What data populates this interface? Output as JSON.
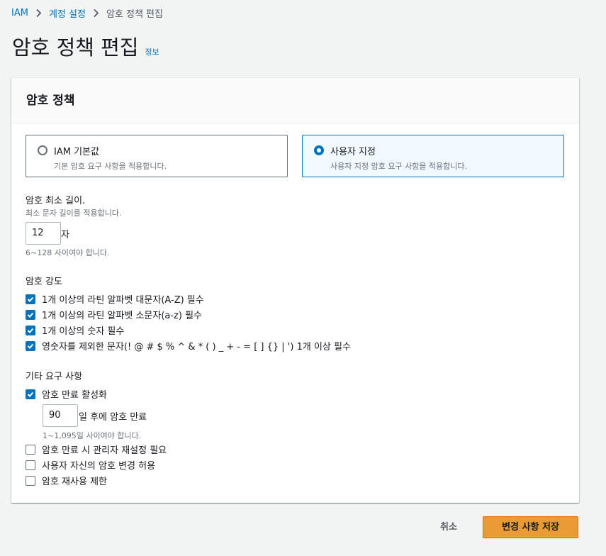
{
  "breadcrumb": {
    "root": "IAM",
    "parent": "계정 설정",
    "current": "암호 정책 편집"
  },
  "page": {
    "title": "암호 정책 편집",
    "info": "정보"
  },
  "card": {
    "title": "암호 정책"
  },
  "policy_options": [
    {
      "label": "IAM 기본값",
      "description": "기본 암호 요구 사항을 적용합니다.",
      "selected": false
    },
    {
      "label": "사용자 지정",
      "description": "사용자 지정 암호 요구 사항을 적용합니다.",
      "selected": true
    }
  ],
  "min_length": {
    "label": "암호 최소 길이.",
    "description": "최소 문자 길이를 적용합니다.",
    "value": "12",
    "unit": "자",
    "hint": "6~128 사이여야 합니다."
  },
  "strength": {
    "label": "암호 강도",
    "items": [
      {
        "label": "1개 이상의 라틴 알파벳 대문자(A-Z) 필수",
        "checked": true
      },
      {
        "label": "1개 이상의 라틴 알파벳 소문자(a-z) 필수",
        "checked": true
      },
      {
        "label": "1개 이상의 숫자 필수",
        "checked": true
      },
      {
        "label": "영숫자를 제외한 문자(! @ # $ % ^ & * ( ) _ + - = [ ] {} | ') 1개 이상 필수",
        "checked": true
      }
    ]
  },
  "other": {
    "label": "기타 요구 사항",
    "expiration": {
      "label": "암호 만료 활성화",
      "checked": true
    },
    "expiration_days": {
      "value": "90",
      "suffix": "일 후에 암호 만료",
      "hint": "1~1,095일 사이여야 합니다."
    },
    "items": [
      {
        "label": "암호 만료 시 관리자 재설정 필요",
        "checked": false
      },
      {
        "label": "사용자 자신의 암호 변경 허용",
        "checked": false
      },
      {
        "label": "암호 재사용 제한",
        "checked": false
      }
    ]
  },
  "actions": {
    "cancel": "취소",
    "save": "변경 사항 저장"
  },
  "colors": {
    "link": "#0073bb",
    "primary_button": "#eb9b35",
    "checkbox": "#0073bb"
  }
}
